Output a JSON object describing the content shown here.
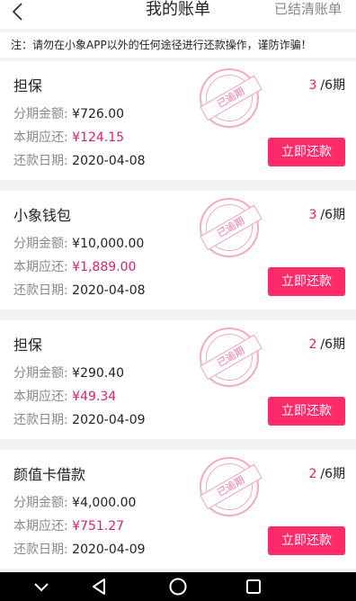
{
  "header": {
    "title": "我的账单",
    "settled_link": "已结清账单",
    "back_icon": "chevron-left-icon"
  },
  "notice": "注：请勿在小象APP以外的任何途径进行还款操作，谨防诈骗！",
  "labels": {
    "amount": "分期金额:",
    "due": "本期应还:",
    "date": "还款日期:",
    "repay_button": "立即还款",
    "overdue_stamp": "已逾期"
  },
  "colors": {
    "accent": "#ff2a6a",
    "due_text": "#e2206a"
  },
  "bills": [
    {
      "name": "担保",
      "current_period": "3",
      "total_periods": "/6期",
      "amount": "¥726.00",
      "due": "¥124.15",
      "date": "2020-04-08"
    },
    {
      "name": "小象钱包",
      "current_period": "3",
      "total_periods": "/6期",
      "amount": "¥10,000.00",
      "due": "¥1,889.00",
      "date": "2020-04-08"
    },
    {
      "name": "担保",
      "current_period": "2",
      "total_periods": "/6期",
      "amount": "¥290.40",
      "due": "¥49.34",
      "date": "2020-04-09"
    },
    {
      "name": "颜值卡借款",
      "current_period": "2",
      "total_periods": "/6期",
      "amount": "¥4,000.00",
      "due": "¥751.27",
      "date": "2020-04-09"
    }
  ],
  "navbar": {
    "icons": [
      "chevron-down-icon",
      "triangle-back-icon",
      "circle-home-icon",
      "square-recents-icon"
    ]
  }
}
